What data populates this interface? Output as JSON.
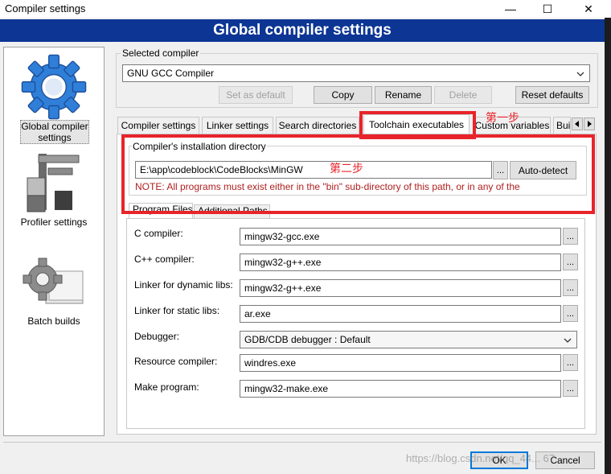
{
  "window": {
    "title": "Compiler settings",
    "minimize_glyph": "—",
    "maximize_glyph": "☐",
    "close_glyph": "✕"
  },
  "banner": {
    "title": "Global compiler settings"
  },
  "sidebar": {
    "items": [
      {
        "label": "Global compiler settings",
        "icon": "gear-icon",
        "selected": true
      },
      {
        "label": "Profiler settings",
        "icon": "caliper-icon"
      },
      {
        "label": "Batch builds",
        "icon": "batch-gear-icon"
      }
    ]
  },
  "selected_compiler": {
    "group_label": "Selected compiler",
    "value": "GNU GCC Compiler",
    "buttons": {
      "set_default": "Set as default",
      "copy": "Copy",
      "rename": "Rename",
      "delete": "Delete",
      "reset": "Reset defaults"
    }
  },
  "tabs": [
    {
      "label": "Compiler settings"
    },
    {
      "label": "Linker settings"
    },
    {
      "label": "Search directories"
    },
    {
      "label": "Toolchain executables",
      "active": true
    },
    {
      "label": "Custom variables"
    },
    {
      "label": "Bui"
    }
  ],
  "annotations": {
    "step1": "第一步",
    "step2": "第二步",
    "highlight_color": "#e8242b"
  },
  "install_dir": {
    "group_label": "Compiler's installation directory",
    "value": "E:\\app\\codeblock\\CodeBlocks\\MinGW",
    "browse": "...",
    "autodetect": "Auto-detect",
    "note": "NOTE: All programs must exist either in the \"bin\" sub-directory of this path, or in any of the"
  },
  "subtabs": [
    {
      "label": "Program Files"
    },
    {
      "label": "Additional Paths"
    }
  ],
  "programs": [
    {
      "label": "C compiler:",
      "value": "mingw32-gcc.exe"
    },
    {
      "label": "C++ compiler:",
      "value": "mingw32-g++.exe"
    },
    {
      "label": "Linker for dynamic libs:",
      "value": "mingw32-g++.exe"
    },
    {
      "label": "Linker for static libs:",
      "value": "ar.exe"
    },
    {
      "label": "Debugger:",
      "value": "GDB/CDB debugger : Default"
    },
    {
      "label": "Resource compiler:",
      "value": "windres.exe"
    },
    {
      "label": "Make program:",
      "value": "mingw32-make.exe"
    }
  ],
  "footer": {
    "ok": "OK",
    "cancel": "Cancel",
    "watermark": "https://blog.csdn.net/qq_44... 67"
  }
}
